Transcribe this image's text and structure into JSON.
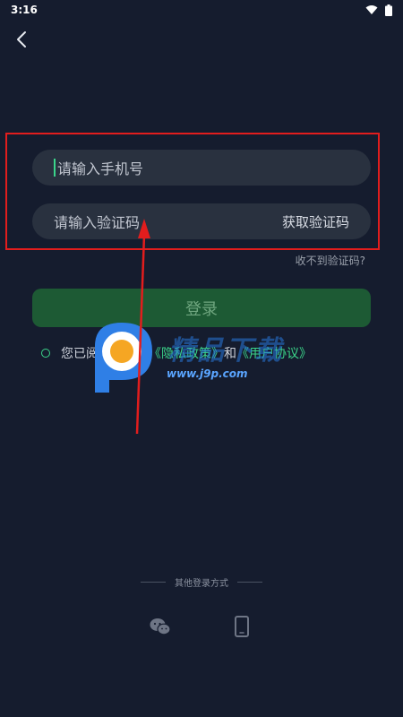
{
  "status_bar": {
    "time": "3:16"
  },
  "form": {
    "phone_placeholder": "请输入手机号",
    "code_placeholder": "请输入验证码",
    "get_code_label": "获取验证码",
    "no_code_link": "收不到验证码?"
  },
  "login_button": "登录",
  "agreement": {
    "prefix": "您已阅读并同意",
    "privacy": "《隐私政策》",
    "conjunction": "和",
    "user_agreement": "《用户协议》"
  },
  "watermark": {
    "name": "精品下载",
    "url": "www.j9p.com"
  },
  "other_login": {
    "label": "其他登录方式",
    "icons": [
      "wechat-icon",
      "mobile-phone-icon"
    ]
  },
  "colors": {
    "background": "#151c2e",
    "input": "#29313f",
    "accent_green": "#3bd58a",
    "login_button": "#1d5a34",
    "annotation_red": "#e21d1d"
  }
}
